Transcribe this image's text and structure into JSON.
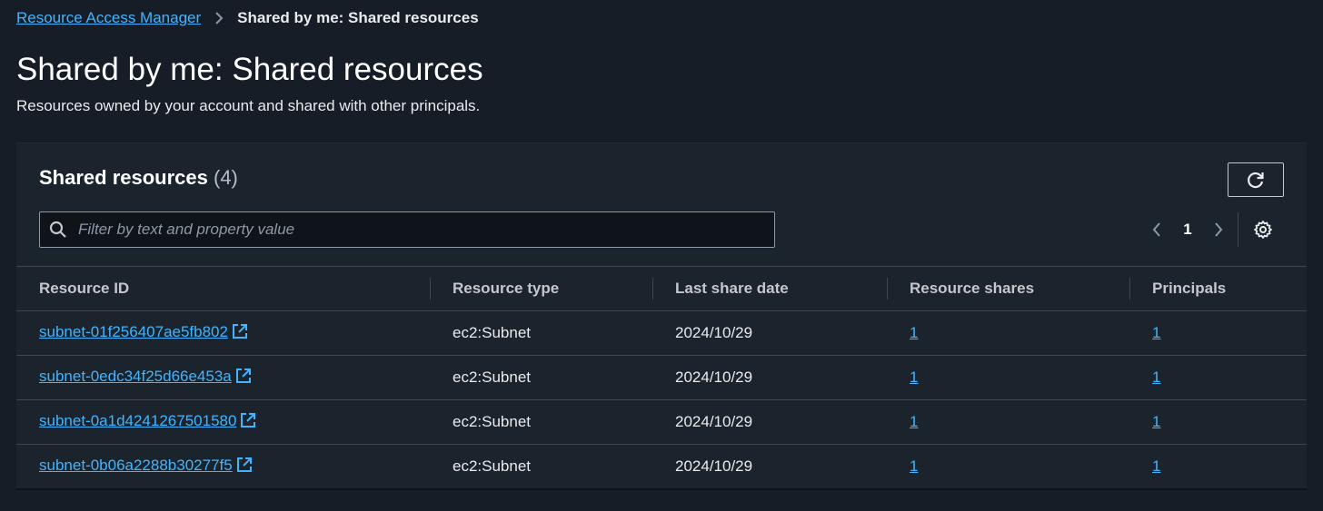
{
  "breadcrumb": {
    "parent": "Resource Access Manager",
    "current": "Shared by me: Shared resources"
  },
  "page": {
    "title": "Shared by me: Shared resources",
    "description": "Resources owned by your account and shared with other principals."
  },
  "container": {
    "title": "Shared resources",
    "count": "(4)",
    "filter_placeholder": "Filter by text and property value",
    "current_page": "1"
  },
  "table": {
    "columns": [
      "Resource ID",
      "Resource type",
      "Last share date",
      "Resource shares",
      "Principals"
    ],
    "rows": [
      {
        "resource_id": "subnet-01f256407ae5fb802",
        "resource_type": "ec2:Subnet",
        "last_share_date": "2024/10/29",
        "resource_shares": "1",
        "principals": "1"
      },
      {
        "resource_id": "subnet-0edc34f25d66e453a",
        "resource_type": "ec2:Subnet",
        "last_share_date": "2024/10/29",
        "resource_shares": "1",
        "principals": "1"
      },
      {
        "resource_id": "subnet-0a1d4241267501580",
        "resource_type": "ec2:Subnet",
        "last_share_date": "2024/10/29",
        "resource_shares": "1",
        "principals": "1"
      },
      {
        "resource_id": "subnet-0b06a2288b30277f5",
        "resource_type": "ec2:Subnet",
        "last_share_date": "2024/10/29",
        "resource_shares": "1",
        "principals": "1"
      }
    ]
  },
  "colors": {
    "background": "#161d26",
    "panel": "#1b232d",
    "link": "#42b4ff",
    "border": "#424650"
  },
  "icons": {
    "breadcrumb_separator": "chevron-right-icon",
    "refresh": "refresh-icon",
    "search": "search-icon",
    "prev_page": "chevron-left-icon",
    "next_page": "chevron-right-icon",
    "settings": "gear-icon",
    "external_link": "external-link-icon"
  }
}
